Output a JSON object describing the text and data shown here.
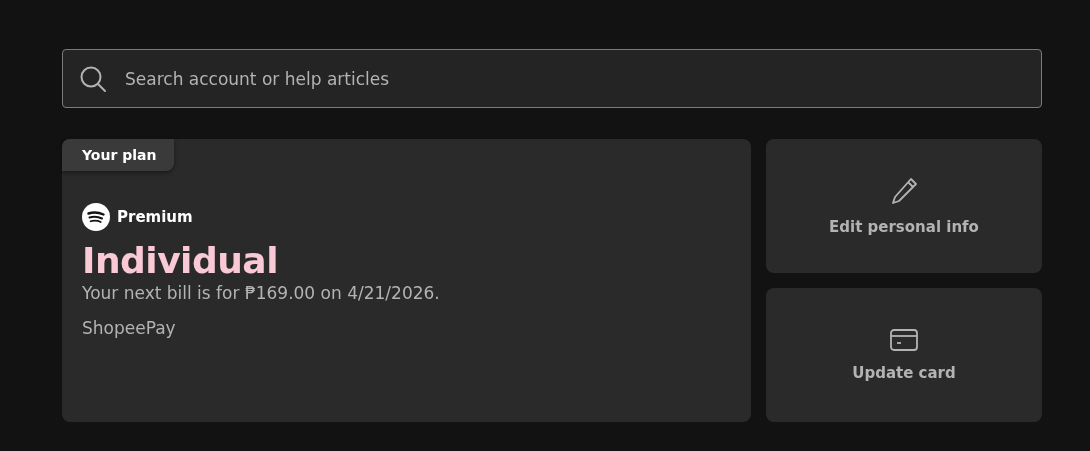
{
  "search": {
    "placeholder": "Search account or help articles"
  },
  "plan": {
    "tag": "Your plan",
    "brand": "Premium",
    "name": "Individual",
    "bill": "Your next bill is for ₱169.00 on 4/21/2026.",
    "payment": "ShopeePay"
  },
  "actions": [
    {
      "kind": "edit",
      "label": "Edit personal info"
    },
    {
      "kind": "card",
      "label": "Update card"
    }
  ]
}
